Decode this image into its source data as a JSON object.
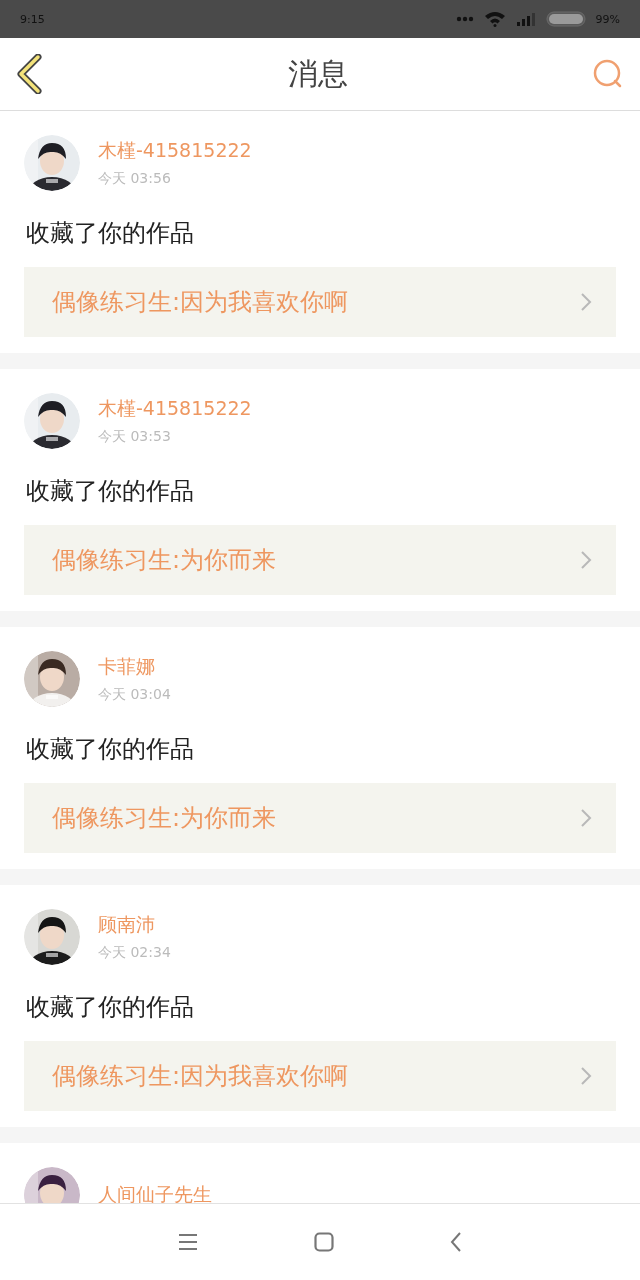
{
  "status_bar": {
    "time": "9:15",
    "battery": "99%"
  },
  "header": {
    "title": "消息"
  },
  "messages": [
    {
      "name": "木槿-415815222",
      "time": "今天 03:56",
      "action": "收藏了你的作品",
      "work": "偶像练习生:因为我喜欢你啊"
    },
    {
      "name": "木槿-415815222",
      "time": "今天 03:53",
      "action": "收藏了你的作品",
      "work": "偶像练习生:为你而来"
    },
    {
      "name": "卡菲娜",
      "time": "今天 03:04",
      "action": "收藏了你的作品",
      "work": "偶像练习生:为你而来"
    },
    {
      "name": "顾南沛",
      "time": "今天 02:34",
      "action": "收藏了你的作品",
      "work": "偶像练习生:因为我喜欢你啊"
    },
    {
      "name": "人间仙子先生"
    }
  ]
}
